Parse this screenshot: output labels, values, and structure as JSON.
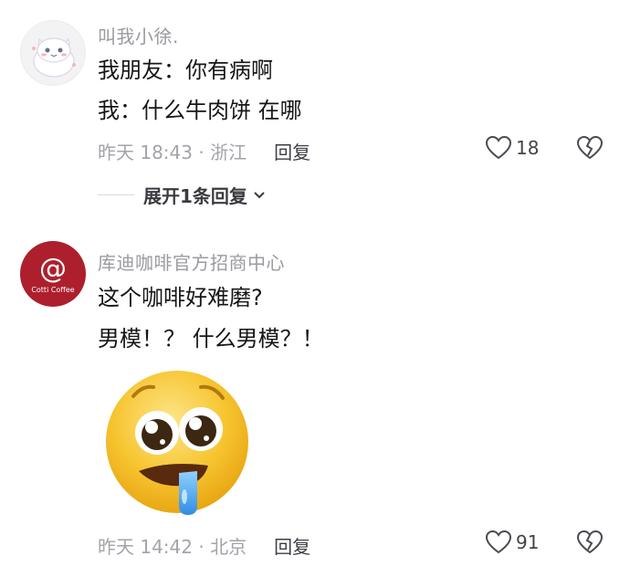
{
  "comments": [
    {
      "username": "叫我小徐.",
      "lines": [
        "我朋友：你有病啊",
        "我：什么牛肉饼 在哪"
      ],
      "time": "昨天 18:43",
      "location": "浙江",
      "reply_label": "回复",
      "likes": "18",
      "expand_label": "展开1条回复"
    },
    {
      "username": "库迪咖啡官方招商中心",
      "avatar_symbol": "@",
      "avatar_text": "Cotti Coffee",
      "lines": [
        "这个咖啡好难磨?",
        "男模！？ 什么男模？！"
      ],
      "time": "昨天 14:42",
      "location": "北京",
      "reply_label": "回复",
      "likes": "91"
    }
  ],
  "colors": {
    "brand_red": "#ad1f2c",
    "emoji_yellow": "#f7c531",
    "meta_gray": "#a3a3aa"
  }
}
